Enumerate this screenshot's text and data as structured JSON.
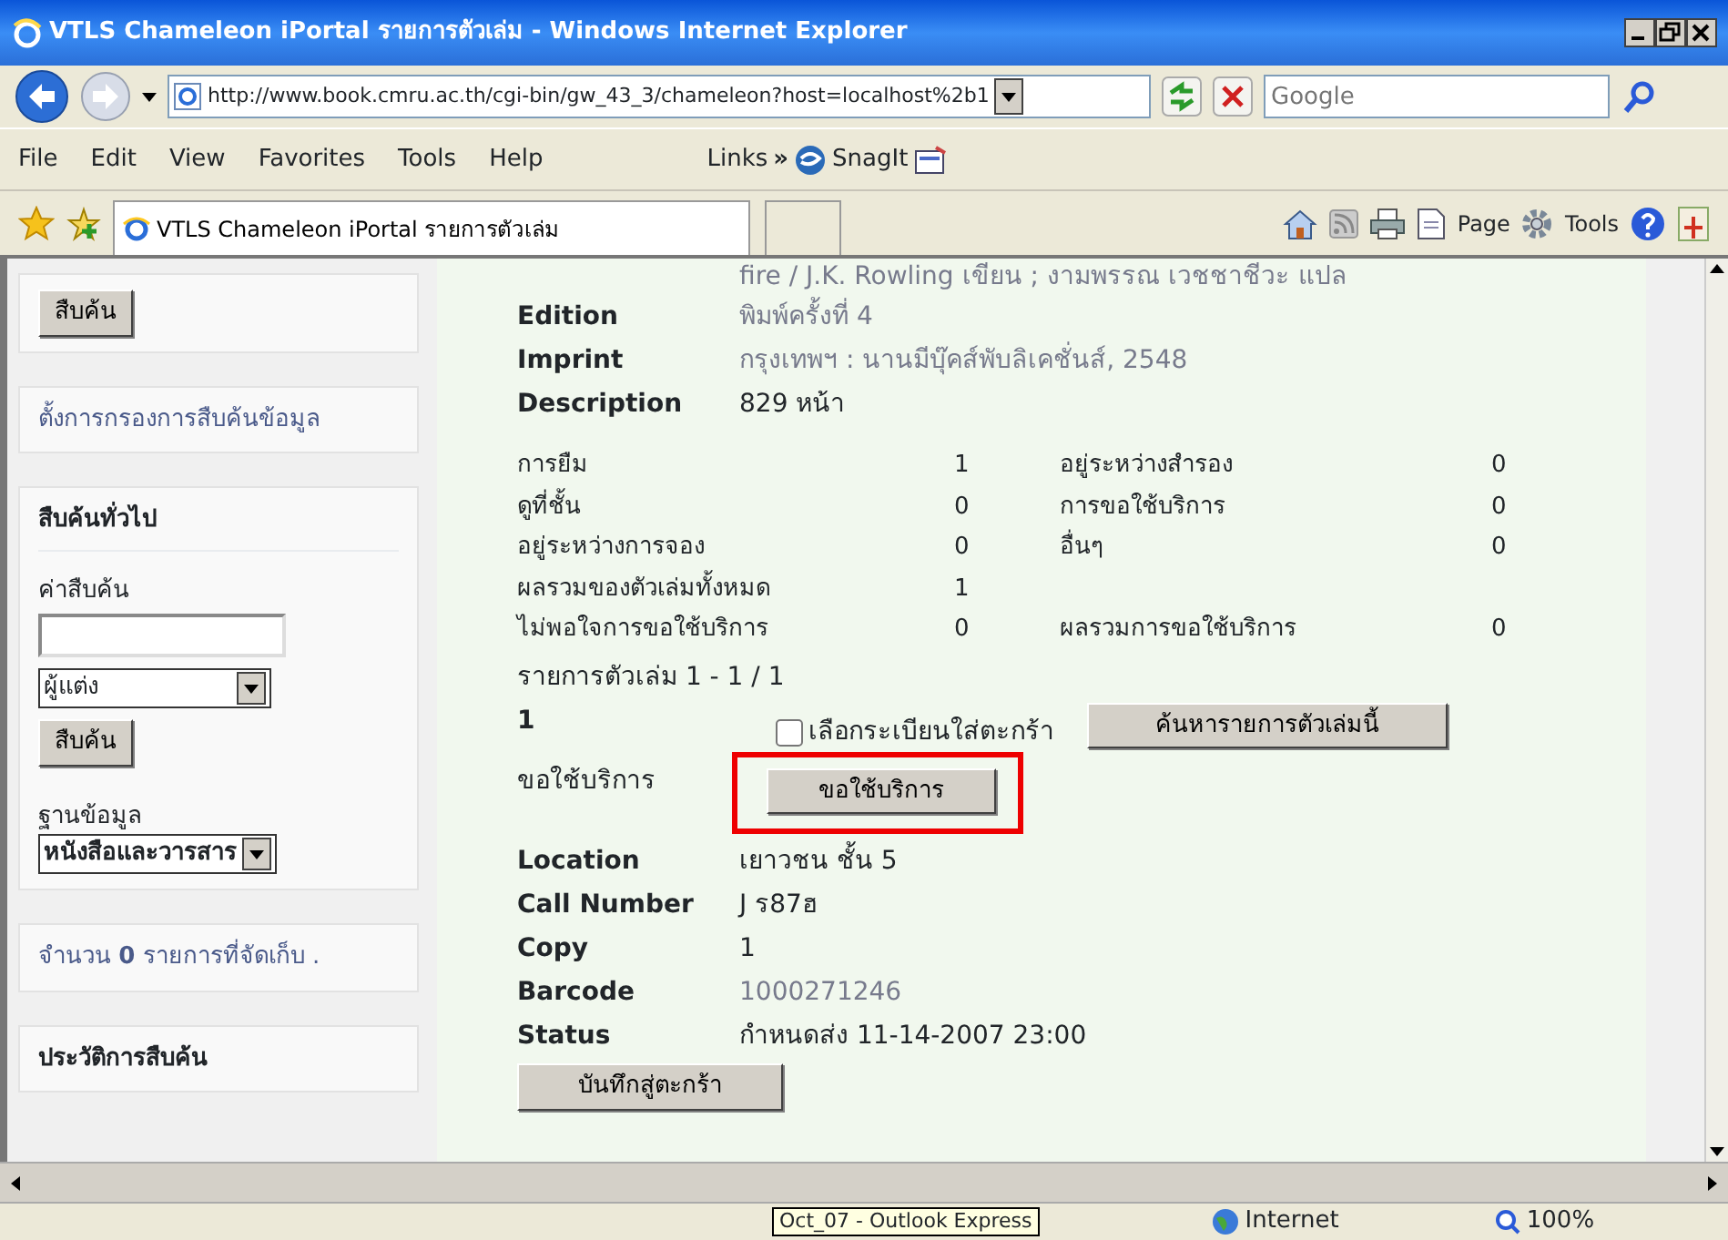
{
  "window": {
    "title": "VTLS Chameleon iPortal รายการตัวเล่ม - Windows Internet Explorer"
  },
  "address_bar": {
    "url": "http://www.book.cmru.ac.th/cgi-bin/gw_43_3/chameleon?host=localhost%2b1",
    "search_placeholder": "Google"
  },
  "menu": [
    "File",
    "Edit",
    "View",
    "Favorites",
    "Tools",
    "Help"
  ],
  "links": {
    "label": "Links",
    "chevron": "»",
    "item": "SnagIt"
  },
  "tabs": [
    {
      "label": "VTLS Chameleon iPortal รายการตัวเล่ม",
      "selected": true
    }
  ],
  "command_bar": [
    "Page",
    "Tools"
  ],
  "sidebar": {
    "search_button": "สืบค้น",
    "filter_link": "ตั้งการกรองการสืบค้นข้อมูล",
    "general_search": {
      "heading": "สืบค้นทั่วไป",
      "term_label": "ค่าสืบค้น",
      "field_select": "ผู้แต่ง",
      "button": "สืบค้น",
      "db_label": "ฐานข้อมูล",
      "db_select": "หนังสือและวารสาร"
    },
    "saved": "จำนวน **0** รายการที่จัดเก็บ .",
    "history_heading": "ประวัติการสืบค้น"
  },
  "record": {
    "title_tail": "fire / J.K. Rowling เขียน ; งามพรรณ เวชชาชีวะ แปล",
    "fields": [
      {
        "label": "Edition",
        "value": "พิมพ์ครั้งที่ 4",
        "kind": "muted"
      },
      {
        "label": "Imprint",
        "value": "กรุงเทพฯ : นานมีบุ๊คส์พับลิเคชั่นส์, 2548",
        "kind": "muted"
      },
      {
        "label": "Description",
        "value": "829 หน้า",
        "kind": "plain"
      }
    ],
    "circulation": [
      [
        "การยืม",
        "1",
        "อยู่ระหว่างสำรอง",
        "0"
      ],
      [
        "ดูที่ชั้น",
        "0",
        "การขอใช้บริการ",
        "0"
      ],
      [
        "อยู่ระหว่างการจอง",
        "0",
        "อื่นๆ",
        "0"
      ],
      [
        "ผลรวมของตัวเล่มทั้งหมด",
        "1"
      ],
      [
        "ไม่พอใจการขอใช้บริการ",
        "0",
        "ผลรวมการขอใช้บริการ",
        "0"
      ]
    ],
    "items_range": "รายการตัวเล่ม 1 - 1 / 1",
    "item": {
      "number": "1",
      "checkbox": {
        "label": "เลือกระเบียนใส่ตะกร้า",
        "checked": false
      },
      "find_button": "ค้นหารายการตัวเล่มนี้",
      "request_label": "ขอใช้บริการ",
      "request_button": "ขอใช้บริการ",
      "request_highlighted": true,
      "fields": [
        {
          "label": "Location",
          "value": "เยาวชน ชั้น 5",
          "kind": "plain"
        },
        {
          "label": "Call Number",
          "value": "J ร87ฮ",
          "kind": "plain"
        },
        {
          "label": "Copy",
          "value": "1",
          "kind": "plain"
        },
        {
          "label": "Barcode",
          "value": "1000271246",
          "kind": "muted"
        },
        {
          "label": "Status",
          "value": "กำหนดส่ง 11-14-2007 23:00",
          "kind": "plain"
        }
      ],
      "save_button": "บันทึกสู่ตะกร้า"
    }
  },
  "status_bar": {
    "tooltip": "Oct_07 - Outlook Express",
    "zone": "Internet",
    "zoom": "100%"
  }
}
